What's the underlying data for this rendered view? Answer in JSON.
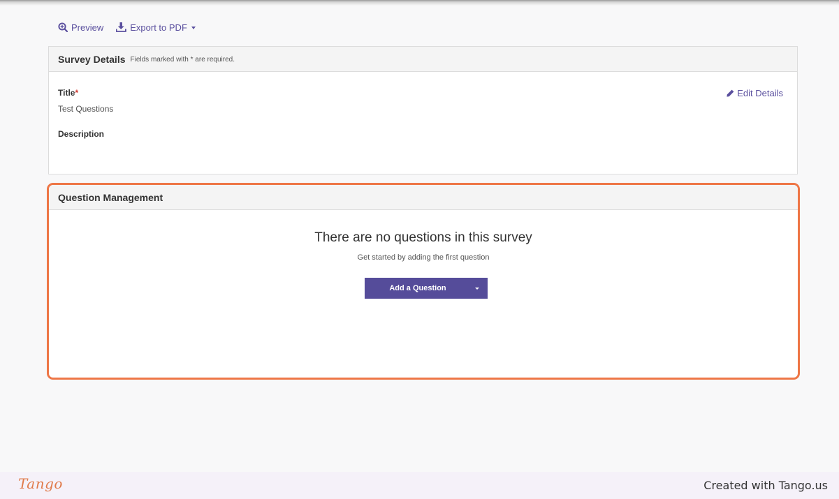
{
  "toolbar": {
    "preview_label": "Preview",
    "export_label": "Export to PDF"
  },
  "survey_details": {
    "title": "Survey Details",
    "note": "Fields marked with * are required.",
    "edit_label": "Edit Details",
    "fields": {
      "title_label": "Title",
      "required_mark": "*",
      "title_value": "Test Questions",
      "description_label": "Description"
    }
  },
  "question_management": {
    "title": "Question Management",
    "empty_title": "There are no questions in this survey",
    "empty_subtitle": "Get started by adding the first question",
    "add_button_label": "Add a Question"
  },
  "footer": {
    "logo": "Tango",
    "credit": "Created with Tango.us"
  },
  "colors": {
    "accent": "#554c9a",
    "link": "#5a4f9e",
    "highlight": "#ee7646",
    "required": "#d0342c"
  },
  "icons": [
    "zoom-in-icon",
    "download-icon",
    "caret-down-icon",
    "pencil-icon"
  ]
}
